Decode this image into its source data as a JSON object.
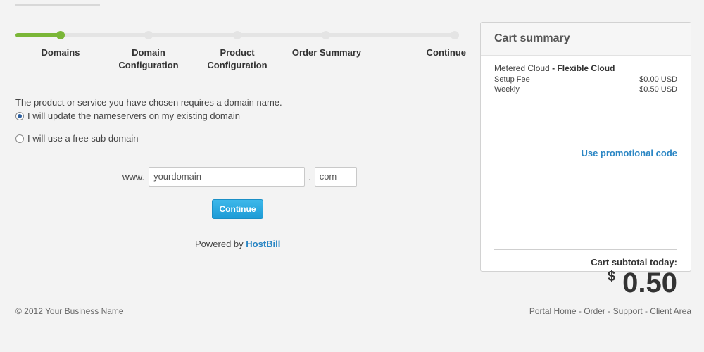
{
  "steps": {
    "progress": 0.1,
    "items": [
      {
        "label": "Domains"
      },
      {
        "label": "Domain Configuration"
      },
      {
        "label": "Product Configuration"
      },
      {
        "label": "Order Summary"
      },
      {
        "label": "Continue"
      }
    ]
  },
  "main": {
    "intro": "The product or service you have chosen requires a domain name.",
    "option_existing": "I will update the nameservers on my existing domain",
    "option_subdomain": "I will use a free sub domain",
    "www_prefix": "www.",
    "domain_value": "yourdomain",
    "dot_separator": ".",
    "tld_value": "com",
    "continue_label": "Continue",
    "powered_by": "Powered by",
    "brand": "HostBill"
  },
  "cart": {
    "title": "Cart summary",
    "product_name": "Metered Cloud",
    "product_dash": "-",
    "product_plan": "Flexible Cloud",
    "fees": [
      {
        "label": "Setup Fee",
        "value": "$0.00 USD"
      },
      {
        "label": "Weekly",
        "value": "$0.50 USD"
      }
    ],
    "promo_label": "Use promotional code",
    "subtotal_label": "Cart subtotal today:",
    "currency": "$",
    "subtotal_amount": "0.50"
  },
  "footer": {
    "copyright": "© 2012 Your Business Name",
    "links": [
      "Portal Home",
      "Order",
      "Support",
      "Client Area"
    ],
    "separator": " - "
  },
  "colors": {
    "accent_green": "#7ab637",
    "link_blue": "#2a86c4",
    "button_blue": "#1d9bd6"
  }
}
